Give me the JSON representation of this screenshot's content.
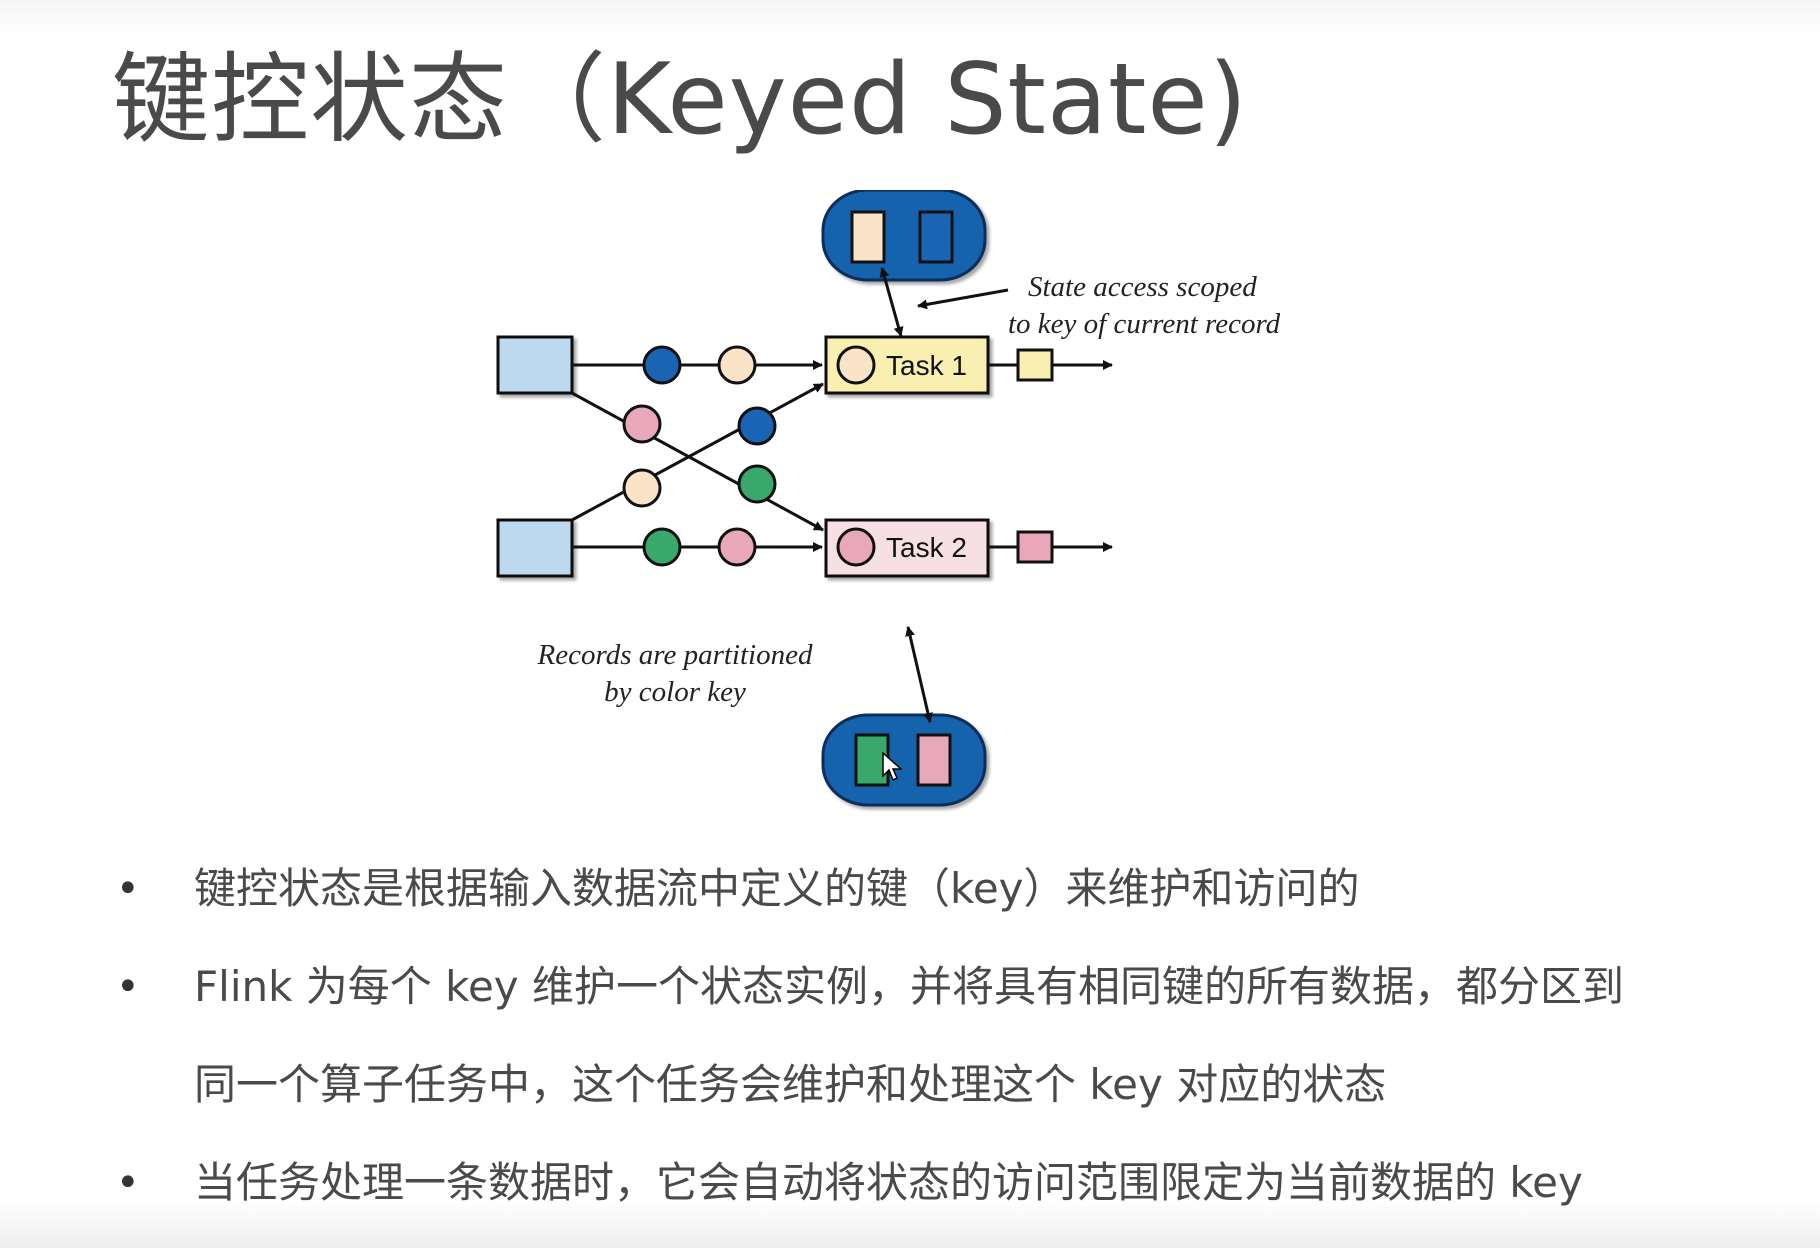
{
  "slide": {
    "title": "键控状态（Keyed State)"
  },
  "diagram": {
    "tasks": [
      {
        "label": "Task 1",
        "color": "#f8efb0",
        "key_color": "#fbe3c8"
      },
      {
        "label": "Task 2",
        "color": "#f6e0e4",
        "key_color": "#e9a8ba"
      }
    ],
    "annotations": {
      "state_access_line1": "State access scoped",
      "state_access_line2": "to key of current record",
      "partition_line1": "Records are partitioned",
      "partition_line2": "by color key"
    },
    "colors": {
      "source": "#bcd9ef",
      "blue_key": "#1a64b3",
      "peach_key": "#fbe3c8",
      "pink_key": "#e9a8ba",
      "green_key": "#3aa86b",
      "state_store": "#1463ad",
      "output_task1": "#f8efb0",
      "output_task2": "#e9a8ba"
    }
  },
  "bullets": [
    {
      "lines": [
        "键控状态是根据输入数据流中定义的键（key）来维护和访问的"
      ]
    },
    {
      "lines": [
        "Flink 为每个 key 维护一个状态实例，并将具有相同键的所有数据，都分区到",
        "同一个算子任务中，这个任务会维护和处理这个 key 对应的状态"
      ]
    },
    {
      "lines": [
        "当任务处理一条数据时，它会自动将状态的访问范围限定为当前数据的 key"
      ]
    }
  ]
}
